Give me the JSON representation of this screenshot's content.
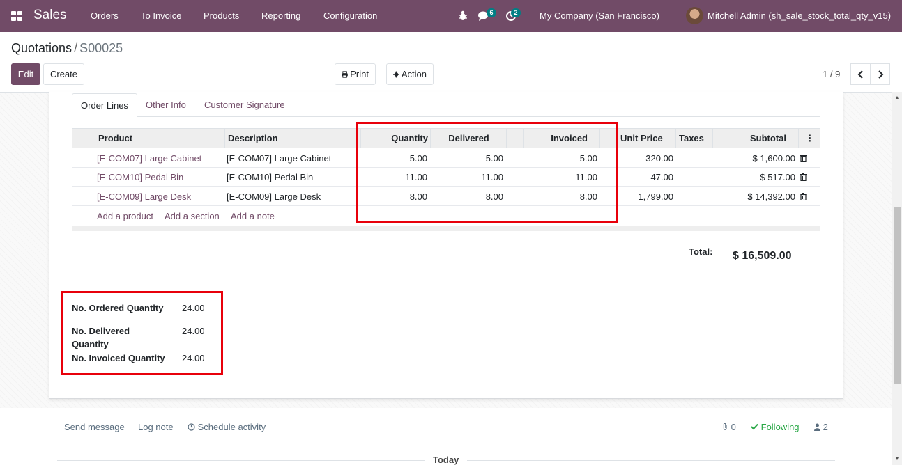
{
  "navbar": {
    "app_name": "Sales",
    "menu": [
      "Orders",
      "To Invoice",
      "Products",
      "Reporting",
      "Configuration"
    ],
    "messages_count": "6",
    "activities_count": "2",
    "company": "My Company (San Francisco)",
    "user": "Mitchell Admin (sh_sale_stock_total_qty_v15)"
  },
  "breadcrumb": {
    "parent": "Quotations",
    "separator": "/",
    "current": "S00025"
  },
  "controls": {
    "edit_label": "Edit",
    "create_label": "Create",
    "print_label": "Print",
    "action_label": "Action",
    "pager": "1 / 9"
  },
  "tabs": [
    "Order Lines",
    "Other Info",
    "Customer Signature"
  ],
  "table": {
    "headers": {
      "product": "Product",
      "description": "Description",
      "quantity": "Quantity",
      "delivered": "Delivered",
      "invoiced": "Invoiced",
      "unit_price": "Unit Price",
      "taxes": "Taxes",
      "subtotal": "Subtotal"
    },
    "rows": [
      {
        "product": "[E-COM07] Large Cabinet",
        "description": "[E-COM07] Large Cabinet",
        "quantity": "5.00",
        "delivered": "5.00",
        "invoiced": "5.00",
        "unit_price": "320.00",
        "taxes": "",
        "subtotal": "$ 1,600.00"
      },
      {
        "product": "[E-COM10] Pedal Bin",
        "description": "[E-COM10] Pedal Bin",
        "quantity": "11.00",
        "delivered": "11.00",
        "invoiced": "11.00",
        "unit_price": "47.00",
        "taxes": "",
        "subtotal": "$ 517.00"
      },
      {
        "product": "[E-COM09] Large Desk",
        "description": "[E-COM09] Large Desk",
        "quantity": "8.00",
        "delivered": "8.00",
        "invoiced": "8.00",
        "unit_price": "1,799.00",
        "taxes": "",
        "subtotal": "$ 14,392.00"
      }
    ],
    "add_product": "Add a product",
    "add_section": "Add a section",
    "add_note": "Add a note"
  },
  "totals": {
    "label": "Total:",
    "value": "$ 16,509.00"
  },
  "quantities": {
    "ordered_label": "No. Ordered Quantity",
    "ordered_value": "24.00",
    "delivered_label": "No. Delivered Quantity",
    "delivered_value": "24.00",
    "invoiced_label": "No. Invoiced Quantity",
    "invoiced_value": "24.00"
  },
  "chatter": {
    "send_message": "Send message",
    "log_note": "Log note",
    "schedule_activity": "Schedule activity",
    "attachments": "0",
    "following": "Following",
    "followers": "2",
    "today": "Today"
  },
  "colors": {
    "brand": "#714B67",
    "highlight": "#e8000b",
    "badge": "#017e84",
    "following": "#28a745"
  }
}
